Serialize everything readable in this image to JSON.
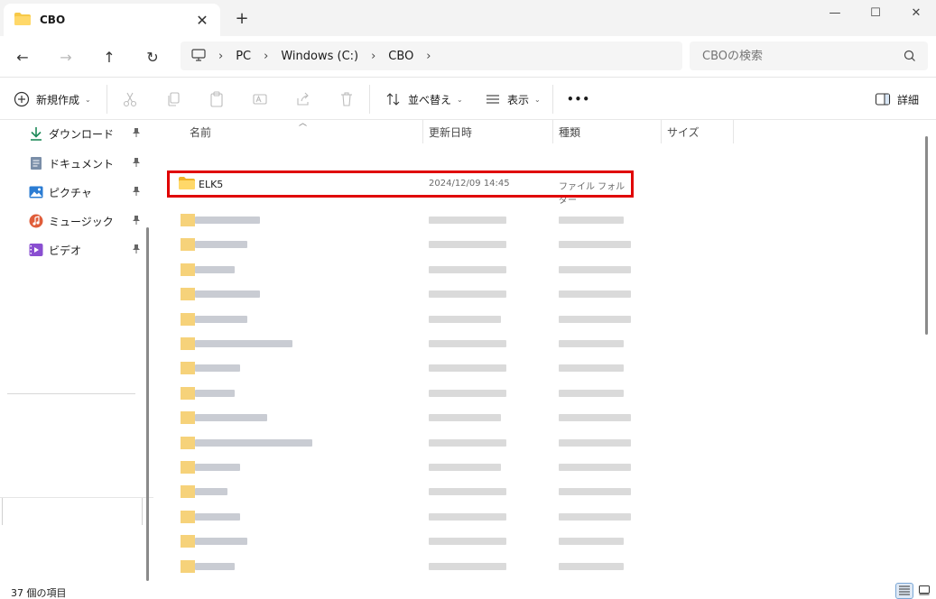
{
  "window": {
    "tab_title": "CBO",
    "close_tab_glyph": "✕",
    "new_tab_glyph": "+",
    "minimize_glyph": "—",
    "maximize_glyph": "☐",
    "close_glyph": "✕"
  },
  "nav": {
    "back_glyph": "←",
    "forward_glyph": "→",
    "up_glyph": "↑",
    "refresh_glyph": "↻",
    "breadcrumb": [
      "PC",
      "Windows (C:)",
      "CBO"
    ],
    "search_placeholder": "CBOの検索"
  },
  "commands": {
    "new_label": "新規作成",
    "sort_label": "並べ替え",
    "view_label": "表示",
    "more_label": "•••",
    "details_label": "詳細"
  },
  "sidebar": {
    "items": [
      {
        "label": "ダウンロード",
        "icon": "download-icon"
      },
      {
        "label": "ドキュメント",
        "icon": "documents-icon"
      },
      {
        "label": "ピクチャ",
        "icon": "pictures-icon"
      },
      {
        "label": "ミュージック",
        "icon": "music-icon"
      },
      {
        "label": "ビデオ",
        "icon": "videos-icon"
      }
    ],
    "pin_glyph": "📌"
  },
  "columns": {
    "name": "名前",
    "date": "更新日時",
    "type": "種類",
    "size": "サイズ"
  },
  "files": [
    {
      "name": "ELK5",
      "date": "2024/12/09 14:45",
      "type": "ファイル フォルダー"
    }
  ],
  "status": {
    "item_count": "37 個の項目"
  },
  "colors": {
    "folder": "#f7c948",
    "highlight": "#e00000",
    "accent": "#0067c0"
  }
}
